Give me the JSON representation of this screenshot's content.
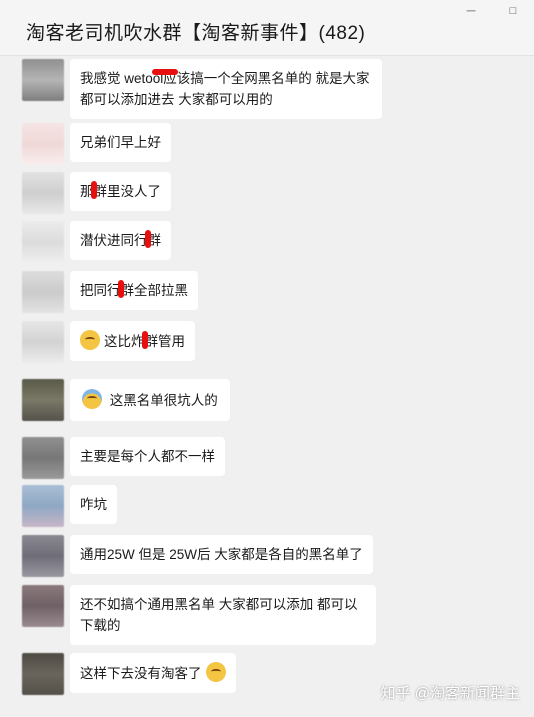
{
  "header": {
    "title": "淘客老司机吹水群【淘客新事件】(482)",
    "window_controls": [
      "ㅡ",
      "□"
    ]
  },
  "messages": [
    {
      "text": "我感觉 wetool应该搞一个全网黑名单的 就是大家都可以添加进去 大家都可以用的",
      "avatar_color": "#9a9a9a"
    },
    {
      "text": "兄弟们早上好",
      "avatar_color": "#f2dede"
    },
    {
      "text_a": "那",
      "text_b": "群里没人了",
      "avatar_color": "#d6d6d6"
    },
    {
      "text_a": "潜伏进同行",
      "text_b": "群",
      "avatar_color": "#e3e3e3"
    },
    {
      "text_a": "把同行",
      "text_b": "群全部拉黑",
      "avatar_color": "#d4d4d4"
    },
    {
      "text_a": "这比炸",
      "text_b": "群管用",
      "avatar_color": "#dcdcdc",
      "emoji": "sweat-smile-icon"
    },
    {
      "text": "这黑名单很坑人的",
      "avatar_color": "#6b6a5a",
      "emoji": "fearful-face-icon"
    },
    {
      "text": "主要是每个人都不一样",
      "avatar_color": "#8a8a8a"
    },
    {
      "text": "咋坑",
      "avatar_color": "#9ab2cc"
    },
    {
      "text": "通用25W 但是 25W后 大家都是各自的黑名单了",
      "avatar_color": "#7d7a84"
    },
    {
      "text": "还不如搞个通用黑名单 大家都可以添加 都可以下载的",
      "avatar_color": "#7a6a6e"
    },
    {
      "text": "这样下去没有淘客了",
      "avatar_color": "#5a5650",
      "emoji": "sad-sweat-icon"
    }
  ],
  "watermark": "知乎 @淘客新闻群主"
}
